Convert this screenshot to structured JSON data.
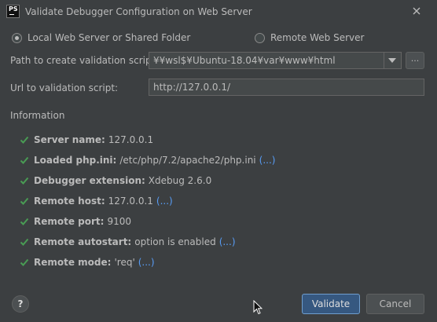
{
  "window": {
    "app_badge": "PS",
    "title": "Validate Debugger Configuration on Web Server"
  },
  "mode": {
    "options": [
      {
        "label": "Local Web Server or Shared Folder",
        "selected": true
      },
      {
        "label": "Remote Web Server",
        "selected": false
      }
    ]
  },
  "form": {
    "path_label": "Path to create validation script:",
    "path_value": "¥¥wsl$¥Ubuntu-18.04¥var¥www¥html",
    "browse_label": "...",
    "url_label": "Url to validation script:",
    "url_value": "http://127.0.0.1/"
  },
  "information": {
    "heading": "Information",
    "check_color": "#499c54",
    "items": [
      {
        "label": "Server name:",
        "value": "127.0.0.1",
        "more": ""
      },
      {
        "label": "Loaded php.ini:",
        "value": "/etc/php/7.2/apache2/php.ini",
        "more": "(...)"
      },
      {
        "label": "Debugger extension:",
        "value": "Xdebug 2.6.0",
        "more": ""
      },
      {
        "label": "Remote host:",
        "value": "127.0.0.1",
        "more": "(...)"
      },
      {
        "label": "Remote port:",
        "value": "9100",
        "more": ""
      },
      {
        "label": "Remote autostart:",
        "value": "option is enabled",
        "more": "(...)"
      },
      {
        "label": "Remote mode:",
        "value": "'req'",
        "more": "(...)"
      }
    ]
  },
  "footer": {
    "help_label": "?",
    "validate_label": "Validate",
    "cancel_label": "Cancel"
  }
}
